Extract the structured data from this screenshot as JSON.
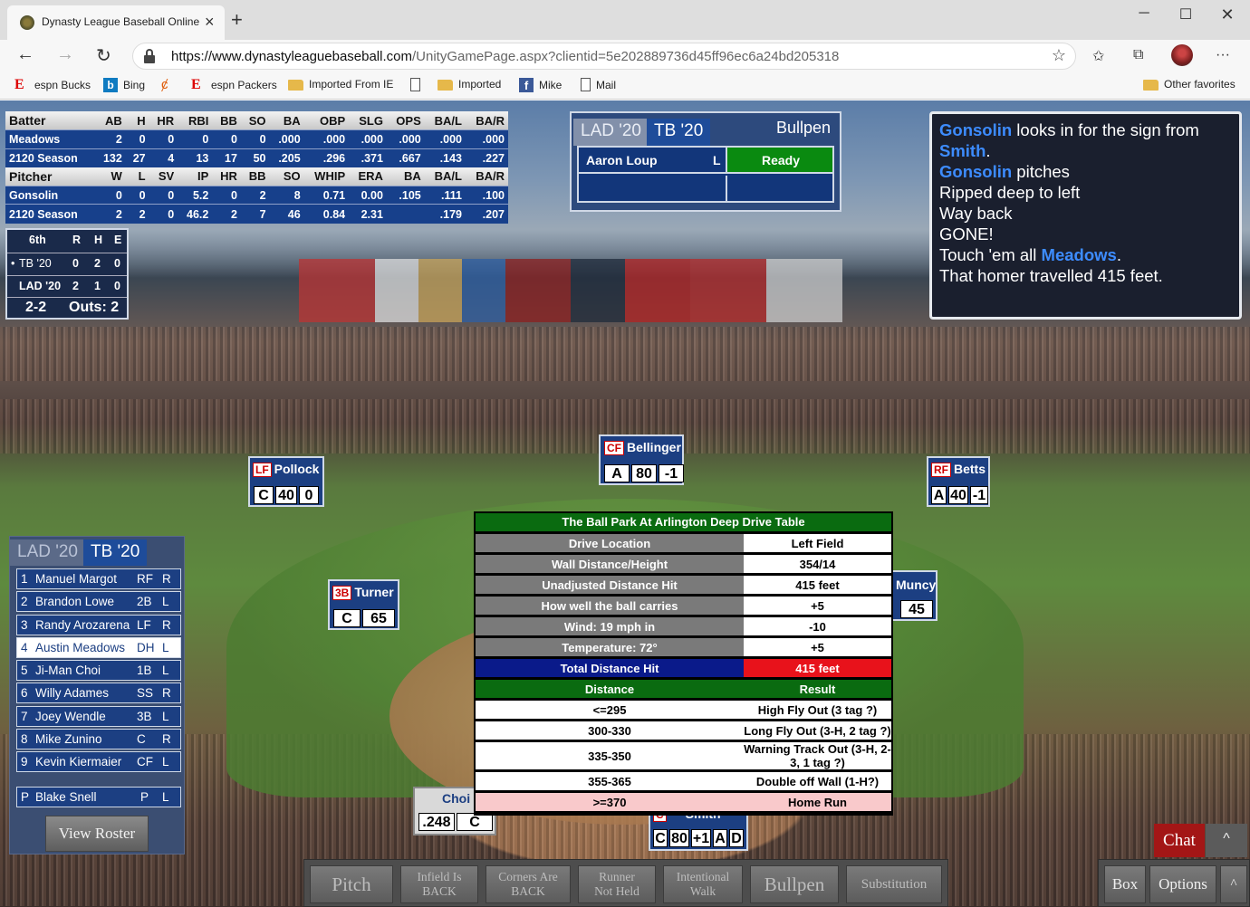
{
  "browser": {
    "tab_title": "Dynasty League Baseball Online",
    "url_domain": "https://www.dynastyleaguebaseball.com",
    "url_path": "/UnityGamePage.aspx?clientid=5e202889736d45ff96ec6a24bd205318",
    "favorites": [
      {
        "label": "espn Bucks",
        "icon": "espn-icon"
      },
      {
        "label": "Bing",
        "icon": "bing-icon"
      },
      {
        "label": "",
        "icon": "swirl-icon"
      },
      {
        "label": "espn Packers",
        "icon": "espn-icon"
      },
      {
        "label": "Imported From IE",
        "icon": "folder-icon"
      },
      {
        "label": "",
        "icon": "page-icon"
      },
      {
        "label": "Imported",
        "icon": "folder-icon"
      },
      {
        "label": "Mike",
        "icon": "facebook-icon"
      },
      {
        "label": "Mail",
        "icon": "page-icon"
      }
    ],
    "other_favorites": "Other favorites"
  },
  "stats": {
    "batter_header": [
      "Batter",
      "AB",
      "H",
      "HR",
      "RBI",
      "BB",
      "SO",
      "BA",
      "OBP",
      "SLG",
      "OPS",
      "BA/L",
      "BA/R"
    ],
    "batter_rows": [
      [
        "Meadows",
        "2",
        "0",
        "0",
        "0",
        "0",
        "0",
        ".000",
        ".000",
        ".000",
        ".000",
        ".000",
        ".000"
      ],
      [
        "2120 Season",
        "132",
        "27",
        "4",
        "13",
        "17",
        "50",
        ".205",
        ".296",
        ".371",
        ".667",
        ".143",
        ".227"
      ]
    ],
    "pitcher_header": [
      "Pitcher",
      "W",
      "L",
      "SV",
      "IP",
      "HR",
      "BB",
      "SO",
      "WHIP",
      "ERA",
      "BA",
      "BA/L",
      "BA/R"
    ],
    "pitcher_rows": [
      [
        "Gonsolin",
        "0",
        "0",
        "0",
        "5.2",
        "0",
        "2",
        "8",
        "0.71",
        "0.00",
        ".105",
        ".111",
        ".100"
      ],
      [
        "2120 Season",
        "2",
        "2",
        "0",
        "46.2",
        "2",
        "7",
        "46",
        "0.84",
        "2.31",
        "",
        ".179",
        ".207"
      ]
    ]
  },
  "linescore": {
    "inning": "6th",
    "cols": [
      "R",
      "H",
      "E"
    ],
    "teams": [
      {
        "name": "TB '20",
        "r": "0",
        "h": "2",
        "e": "0",
        "batting": true
      },
      {
        "name": "LAD '20",
        "r": "2",
        "h": "1",
        "e": "0",
        "batting": false
      }
    ],
    "count": "2-2",
    "outs": "Outs: 2"
  },
  "bullpen": {
    "tab_away": "LAD '20",
    "tab_home": "TB '20",
    "title": "Bullpen",
    "pitcher_name": "Aaron Loup",
    "pitcher_hand": "L",
    "status": "Ready",
    "status_color": "#0a8a10"
  },
  "pbp": {
    "lines": [
      {
        "name": "Gonsolin",
        "text": " looks in for the sign from"
      },
      {
        "name": "Smith",
        "text": "."
      },
      {
        "name": "Gonsolin",
        "text": " pitches"
      },
      {
        "name": "",
        "text": "Ripped deep to left"
      },
      {
        "name": "",
        "text": "Way back"
      },
      {
        "name": "",
        "text": "GONE!"
      },
      {
        "name": "",
        "text": "Touch 'em all ",
        "tail_name": "Meadows",
        "tail": "."
      },
      {
        "name": "",
        "text": "That homer travelled 415 feet."
      }
    ]
  },
  "fielders": {
    "cf": {
      "pos": "CF",
      "name": "Bellinger",
      "ratings": [
        "A",
        "80",
        "-1"
      ]
    },
    "lf": {
      "pos": "LF",
      "name": "Pollock",
      "ratings": [
        "C",
        "40",
        "0"
      ]
    },
    "rf": {
      "pos": "RF",
      "name": "Betts",
      "ratings": [
        "A",
        "40",
        "-1"
      ]
    },
    "third": {
      "pos": "3B",
      "name": "Turner",
      "ratings": [
        "C",
        "65"
      ]
    },
    "first": {
      "name": "Muncy",
      "ratings": [
        "45"
      ]
    },
    "batter": {
      "name": "Choi",
      "ratings": [
        ".248",
        "C"
      ]
    },
    "catcher": {
      "pos": "C",
      "name": "Smith",
      "ratings": [
        "C",
        "80",
        "+1",
        "A",
        "D"
      ]
    }
  },
  "drive_table": {
    "title": "The Ball Park At Arlington Deep Drive Table",
    "rows": [
      {
        "label": "Drive Location",
        "value": "Left Field"
      },
      {
        "label": "Wall Distance/Height",
        "value": "354/14"
      },
      {
        "label": "Unadjusted Distance Hit",
        "value": "415 feet"
      },
      {
        "label": "How well the ball carries",
        "value": "+5"
      },
      {
        "label": "Wind: 19 mph in",
        "value": "-10"
      },
      {
        "label": "Temperature: 72°",
        "value": "+5"
      }
    ],
    "total_label": "Total Distance Hit",
    "total_value": "415 feet",
    "col_distance": "Distance",
    "col_result": "Result",
    "results": [
      {
        "distance": "<=295",
        "result": "High Fly Out (3 tag ?)",
        "highlight": false
      },
      {
        "distance": "300-330",
        "result": "Long Fly Out (3-H, 2 tag ?)",
        "highlight": false
      },
      {
        "distance": "335-350",
        "result": "Warning Track Out (3-H, 2-3, 1 tag ?)",
        "highlight": false
      },
      {
        "distance": "355-365",
        "result": "Double off Wall (1-H?)",
        "highlight": false
      },
      {
        "distance": ">=370",
        "result": "Home Run",
        "highlight": true
      }
    ]
  },
  "lineup": {
    "tab_away": "LAD '20",
    "tab_home": "TB '20",
    "batters": [
      {
        "num": "1",
        "name": "Manuel Margot",
        "pos": "RF",
        "hand": "R",
        "selected": false
      },
      {
        "num": "2",
        "name": "Brandon Lowe",
        "pos": "2B",
        "hand": "L",
        "selected": false
      },
      {
        "num": "3",
        "name": "Randy Arozarena",
        "pos": "LF",
        "hand": "R",
        "selected": false
      },
      {
        "num": "4",
        "name": "Austin Meadows",
        "pos": "DH",
        "hand": "L",
        "selected": true
      },
      {
        "num": "5",
        "name": "Ji-Man Choi",
        "pos": "1B",
        "hand": "L",
        "selected": false
      },
      {
        "num": "6",
        "name": "Willy Adames",
        "pos": "SS",
        "hand": "R",
        "selected": false
      },
      {
        "num": "7",
        "name": "Joey Wendle",
        "pos": "3B",
        "hand": "L",
        "selected": false
      },
      {
        "num": "8",
        "name": "Mike Zunino",
        "pos": "C",
        "hand": "R",
        "selected": false
      },
      {
        "num": "9",
        "name": "Kevin Kiermaier",
        "pos": "CF",
        "hand": "L",
        "selected": false
      }
    ],
    "pitcher": {
      "num": "P",
      "name": "Blake Snell",
      "pos": "P",
      "hand": "L"
    },
    "view_roster": "View Roster"
  },
  "actions": {
    "pitch": "Pitch",
    "infield_back_1": "Infield Is",
    "infield_back_2": "BACK",
    "corners_back_1": "Corners Are",
    "corners_back_2": "BACK",
    "runner_1": "Runner",
    "runner_2": "Not Held",
    "walk_1": "Intentional",
    "walk_2": "Walk",
    "bullpen": "Bullpen",
    "substitution": "Substitution",
    "box": "Box",
    "options": "Options",
    "chat": "Chat",
    "caret": "^"
  }
}
